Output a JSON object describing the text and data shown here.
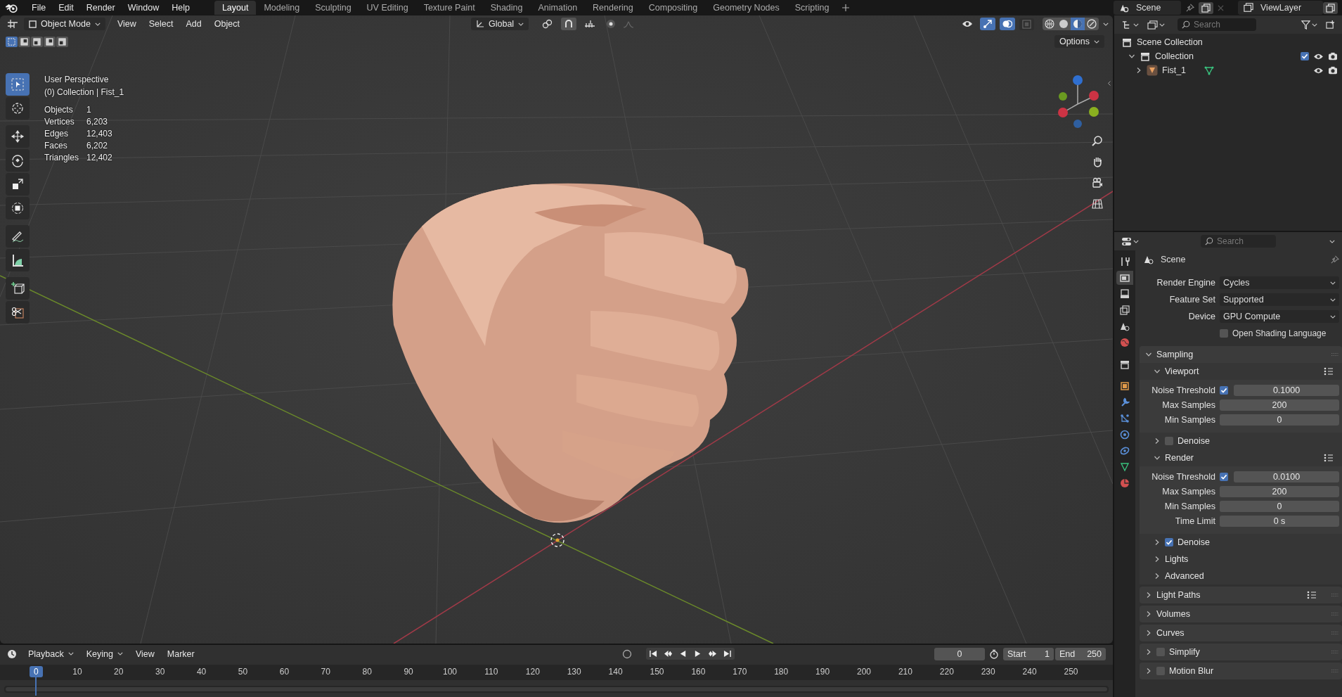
{
  "menu": [
    "File",
    "Edit",
    "Render",
    "Window",
    "Help"
  ],
  "workspaces": [
    {
      "label": "Layout",
      "selected": true
    },
    {
      "label": "Modeling",
      "selected": false
    },
    {
      "label": "Sculpting",
      "selected": false
    },
    {
      "label": "UV Editing",
      "selected": false
    },
    {
      "label": "Texture Paint",
      "selected": false
    },
    {
      "label": "Shading",
      "selected": false
    },
    {
      "label": "Animation",
      "selected": false
    },
    {
      "label": "Rendering",
      "selected": false
    },
    {
      "label": "Compositing",
      "selected": false
    },
    {
      "label": "Geometry Nodes",
      "selected": false
    },
    {
      "label": "Scripting",
      "selected": false
    }
  ],
  "scene": "Scene",
  "view_layer": "ViewLayer",
  "viewport_header": {
    "mode": "Object Mode",
    "menus": [
      "View",
      "Select",
      "Add",
      "Object"
    ],
    "orientation": "Global",
    "options": "Options",
    "shading_modes": [
      {
        "kind": "wireframe",
        "selected": false
      },
      {
        "kind": "solid",
        "selected": false
      },
      {
        "kind": "material",
        "selected": true
      },
      {
        "kind": "rendered",
        "selected": false
      }
    ]
  },
  "select_modes": [
    {
      "selected": true
    },
    {
      "selected": false
    },
    {
      "selected": false
    },
    {
      "selected": false
    },
    {
      "selected": false
    }
  ],
  "tools": [
    {
      "kind": "select",
      "selected": true
    },
    {
      "kind": "cursor",
      "selected": false
    },
    {
      "kind": "move",
      "selected": false
    },
    {
      "kind": "rotate",
      "selected": false
    },
    {
      "kind": "scale",
      "selected": false
    },
    {
      "kind": "transform",
      "selected": false
    },
    {
      "kind": "annotate",
      "selected": false
    },
    {
      "kind": "measure",
      "selected": false
    },
    {
      "kind": "add-cube",
      "selected": false
    },
    {
      "kind": "cut",
      "selected": false
    }
  ],
  "overlay": {
    "perspective": "User Perspective",
    "collection": "(0) Collection | Fist_1",
    "stats": [
      {
        "label": "Objects",
        "value": "1"
      },
      {
        "label": "Vertices",
        "value": "6,203"
      },
      {
        "label": "Edges",
        "value": "12,403"
      },
      {
        "label": "Faces",
        "value": "6,202"
      },
      {
        "label": "Triangles",
        "value": "12,402"
      }
    ]
  },
  "outliner": {
    "search_placeholder": "Search",
    "tree": [
      {
        "label": "Scene Collection",
        "kind": "root",
        "children": [
          {
            "label": "Collection",
            "kind": "collection",
            "expanded": true,
            "checked": true,
            "children": [
              {
                "label": "Fist_1",
                "kind": "object",
                "expanded": false
              }
            ]
          }
        ]
      }
    ]
  },
  "properties": {
    "search_placeholder": "Search",
    "context": "Scene",
    "tabs": [
      {
        "kind": "tool",
        "selected": false
      },
      {
        "kind": "render",
        "selected": true
      },
      {
        "kind": "output",
        "selected": false
      },
      {
        "kind": "view-layer",
        "selected": false
      },
      {
        "kind": "scene",
        "selected": false
      },
      {
        "kind": "world",
        "selected": false
      },
      {
        "kind": "collection",
        "selected": false
      },
      {
        "kind": "object",
        "selected": false
      },
      {
        "kind": "modifier",
        "selected": false
      },
      {
        "kind": "particles",
        "selected": false
      },
      {
        "kind": "physics",
        "selected": false
      },
      {
        "kind": "constraint",
        "selected": false
      },
      {
        "kind": "data",
        "selected": false
      },
      {
        "kind": "material",
        "selected": false
      }
    ],
    "fields": [
      {
        "kind": "dropdown",
        "label": "Render Engine",
        "value": "Cycles"
      },
      {
        "kind": "dropdown",
        "label": "Feature Set",
        "value": "Supported"
      },
      {
        "kind": "dropdown",
        "label": "Device",
        "value": "GPU Compute"
      },
      {
        "kind": "checkbox",
        "label": "Open Shading Language",
        "checked": false
      }
    ],
    "panels": [
      {
        "title": "Sampling",
        "expanded": true,
        "children": [
          {
            "title": "Viewport",
            "expanded": true,
            "presets": true,
            "rows": [
              {
                "kind": "check-number",
                "label": "Noise Threshold",
                "checked": true,
                "value": "0.1000"
              },
              {
                "kind": "number",
                "label": "Max Samples",
                "value": "200"
              },
              {
                "kind": "number",
                "label": "Min Samples",
                "value": "0"
              }
            ]
          },
          {
            "title": "Denoise",
            "expanded": false,
            "checked": false
          },
          {
            "title": "Render",
            "expanded": true,
            "presets": true,
            "rows": [
              {
                "kind": "check-number",
                "label": "Noise Threshold",
                "checked": true,
                "value": "0.0100"
              },
              {
                "kind": "number",
                "label": "Max Samples",
                "value": "200"
              },
              {
                "kind": "number",
                "label": "Min Samples",
                "value": "0"
              },
              {
                "kind": "number",
                "label": "Time Limit",
                "value": "0 s"
              }
            ]
          },
          {
            "title": "Denoise",
            "expanded": false,
            "checked": true
          },
          {
            "title": "Lights",
            "expanded": false
          },
          {
            "title": "Advanced",
            "expanded": false
          }
        ]
      },
      {
        "title": "Light Paths",
        "expanded": false,
        "presets": true
      },
      {
        "title": "Volumes",
        "expanded": false
      },
      {
        "title": "Curves",
        "expanded": false
      },
      {
        "title": "Simplify",
        "expanded": false,
        "checked": false
      },
      {
        "title": "Motion Blur",
        "expanded": false,
        "checked": false
      }
    ]
  },
  "timeline": {
    "menus": [
      "Playback",
      "Keying",
      "View",
      "Marker"
    ],
    "current_frame": "0",
    "start_label": "Start",
    "start": "1",
    "end_label": "End",
    "end": "250",
    "playhead": "0",
    "ticks": [
      "10",
      "20",
      "30",
      "40",
      "50",
      "60",
      "70",
      "80",
      "90",
      "100",
      "110",
      "120",
      "130",
      "140",
      "150",
      "160",
      "170",
      "180",
      "190",
      "200",
      "210",
      "220",
      "230",
      "240",
      "250"
    ]
  }
}
